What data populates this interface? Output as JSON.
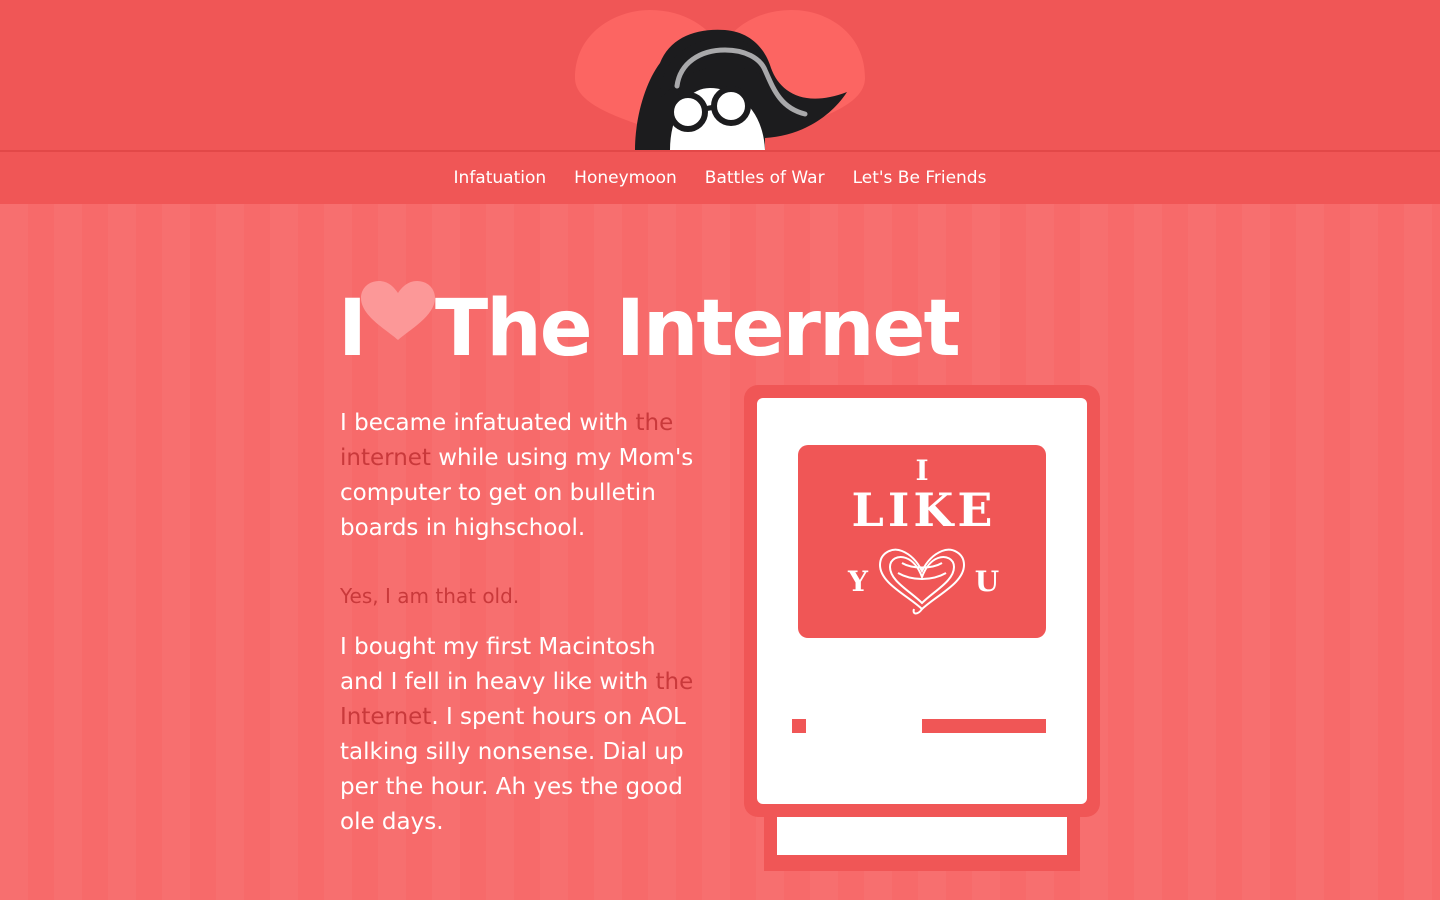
{
  "nav": {
    "items": [
      {
        "label": "Infatuation"
      },
      {
        "label": "Honeymoon"
      },
      {
        "label": "Battles of War"
      },
      {
        "label": "Let's Be Friends"
      }
    ]
  },
  "headline": {
    "prefix": "I",
    "heart_icon": "heart-icon",
    "suffix": "The Internet"
  },
  "content": {
    "para1": {
      "text_before": "I became infatuated with ",
      "link": "the internet",
      "text_after": " while using my Mom's computer to get on bulletin boards in highschool."
    },
    "aside": "Yes, I am that old.",
    "para2": {
      "text_before": "I bought my first Macintosh and I fell in heavy like with ",
      "link": "the Internet",
      "text_after": ". I spent hours on AOL talking silly nonsense. Dial up per the hour. Ah yes the good ole days."
    }
  },
  "illustration": {
    "screen_line1": "I",
    "screen_line2": "LIKE",
    "screen_line3_left": "Y",
    "screen_line3_right": "U"
  },
  "colors": {
    "background": "#f76a6a",
    "header": "#f05656",
    "accent_text": "#c9393b",
    "heart_light": "#fc9898",
    "white": "#ffffff"
  }
}
